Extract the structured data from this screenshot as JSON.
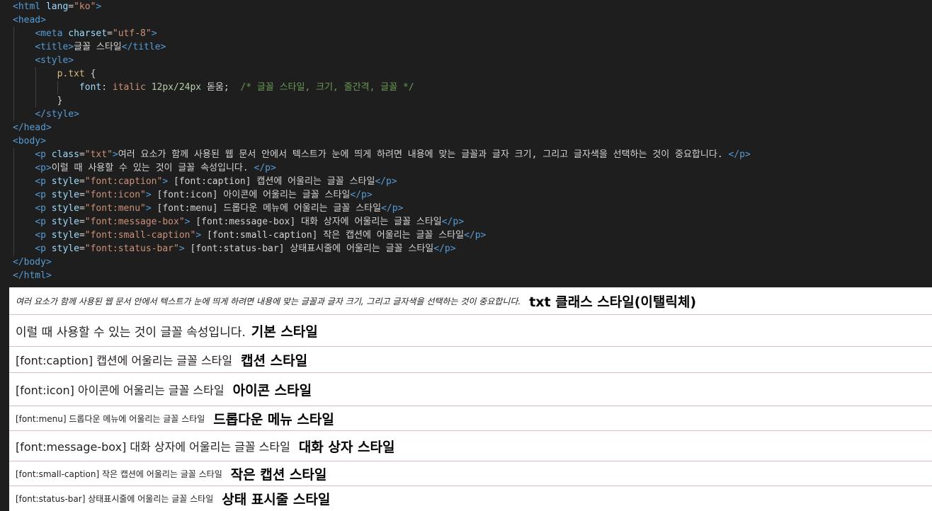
{
  "editor": {
    "lines": [
      [
        [
          "t-tag",
          "<html "
        ],
        [
          "t-attr",
          "lang"
        ],
        [
          "t-txt",
          "="
        ],
        [
          "t-str",
          "\"ko\""
        ],
        [
          "t-tag",
          ">"
        ]
      ],
      [
        [
          "t-tag",
          "<head>"
        ]
      ],
      [
        [
          "t-txt",
          "    "
        ],
        [
          "t-tag",
          "<meta "
        ],
        [
          "t-attr",
          "charset"
        ],
        [
          "t-txt",
          "="
        ],
        [
          "t-str",
          "\"utf-8\""
        ],
        [
          "t-tag",
          ">"
        ]
      ],
      [
        [
          "t-txt",
          "    "
        ],
        [
          "t-tag",
          "<title>"
        ],
        [
          "t-txt",
          "글꼴 스타일"
        ],
        [
          "t-tag",
          "</title>"
        ]
      ],
      [
        [
          "t-txt",
          "    "
        ],
        [
          "t-tag",
          "<style>"
        ]
      ],
      [
        [
          "t-txt",
          "        "
        ],
        [
          "t-sel",
          "p.txt"
        ],
        [
          "t-txt",
          " {"
        ]
      ],
      [
        [
          "t-txt",
          "            "
        ],
        [
          "t-prop",
          "font"
        ],
        [
          "t-txt",
          ": "
        ],
        [
          "t-val",
          "italic "
        ],
        [
          "t-num",
          "12px/24px"
        ],
        [
          "t-txt",
          " 돋움;  "
        ],
        [
          "t-cmt",
          "/* 글꼴 스타일, 크기, 줄간격, 글꼴 */"
        ]
      ],
      [
        [
          "t-txt",
          "        }"
        ]
      ],
      [
        [
          "t-txt",
          "    "
        ],
        [
          "t-tag",
          "</style>"
        ]
      ],
      [
        [
          "t-tag",
          "</head>"
        ]
      ],
      [
        [
          "t-tag",
          "<body>"
        ]
      ],
      [
        [
          "t-txt",
          "    "
        ],
        [
          "t-tag",
          "<p "
        ],
        [
          "t-attr",
          "class"
        ],
        [
          "t-txt",
          "="
        ],
        [
          "t-str",
          "\"txt\""
        ],
        [
          "t-tag",
          ">"
        ],
        [
          "t-txt",
          "여러 요소가 함께 사용된 웹 문서 안에서 텍스트가 눈에 띄게 하려면 내용에 맞는 글꼴과 글자 크기, 그리고 글자색을 선택하는 것이 중요합니다. "
        ],
        [
          "t-tag",
          "</p>"
        ]
      ],
      [
        [
          "t-txt",
          "    "
        ],
        [
          "t-tag",
          "<p>"
        ],
        [
          "t-txt",
          "이럴 때 사용할 수 있는 것이 글꼴 속성입니다. "
        ],
        [
          "t-tag",
          "</p>"
        ]
      ],
      [
        [
          "t-txt",
          "    "
        ],
        [
          "t-tag",
          "<p "
        ],
        [
          "t-attr",
          "style"
        ],
        [
          "t-txt",
          "="
        ],
        [
          "t-str",
          "\"font:caption\""
        ],
        [
          "t-tag",
          ">"
        ],
        [
          "t-txt",
          " [font:caption] 캡션에 어울리는 글꼴 스타일"
        ],
        [
          "t-tag",
          "</p>"
        ]
      ],
      [
        [
          "t-txt",
          "    "
        ],
        [
          "t-tag",
          "<p "
        ],
        [
          "t-attr",
          "style"
        ],
        [
          "t-txt",
          "="
        ],
        [
          "t-str",
          "\"font:icon\""
        ],
        [
          "t-tag",
          ">"
        ],
        [
          "t-txt",
          " [font:icon] 아이콘에 어울리는 글꼴 스타일"
        ],
        [
          "t-tag",
          "</p>"
        ]
      ],
      [
        [
          "t-txt",
          "    "
        ],
        [
          "t-tag",
          "<p "
        ],
        [
          "t-attr",
          "style"
        ],
        [
          "t-txt",
          "="
        ],
        [
          "t-str",
          "\"font:menu\""
        ],
        [
          "t-tag",
          ">"
        ],
        [
          "t-txt",
          " [font:menu] 드롭다운 메뉴에 어울리는 글꼴 스타일"
        ],
        [
          "t-tag",
          "</p>"
        ]
      ],
      [
        [
          "t-txt",
          "    "
        ],
        [
          "t-tag",
          "<p "
        ],
        [
          "t-attr",
          "style"
        ],
        [
          "t-txt",
          "="
        ],
        [
          "t-str",
          "\"font:message-box\""
        ],
        [
          "t-tag",
          ">"
        ],
        [
          "t-txt",
          " [font:message-box] 대화 상자에 어울리는 글꼴 스타일"
        ],
        [
          "t-tag",
          "</p>"
        ]
      ],
      [
        [
          "t-txt",
          "    "
        ],
        [
          "t-tag",
          "<p "
        ],
        [
          "t-attr",
          "style"
        ],
        [
          "t-txt",
          "="
        ],
        [
          "t-str",
          "\"font:small-caption\""
        ],
        [
          "t-tag",
          ">"
        ],
        [
          "t-txt",
          " [font:small-caption] 작은 캡션에 어울리는 글꼴 스타일"
        ],
        [
          "t-tag",
          "</p>"
        ]
      ],
      [
        [
          "t-txt",
          "    "
        ],
        [
          "t-tag",
          "<p "
        ],
        [
          "t-attr",
          "style"
        ],
        [
          "t-txt",
          "="
        ],
        [
          "t-str",
          "\"font:status-bar\""
        ],
        [
          "t-tag",
          ">"
        ],
        [
          "t-txt",
          " [font:status-bar] 상태표시줄에 어울리는 글꼴 스타일"
        ],
        [
          "t-tag",
          "</p>"
        ]
      ],
      [
        [
          "t-tag",
          "</body>"
        ]
      ],
      [
        [
          "t-tag",
          "</html>"
        ]
      ]
    ]
  },
  "preview": {
    "rows": [
      {
        "name": "txt",
        "sample": "여러 요소가 함께 사용된 웹 문서 안에서 텍스트가 눈에 띄게 하려면 내용에 맞는 글꼴과 글자 크기, 그리고 글자색을 선택하는 것이 중요합니다.",
        "label": "txt 클래스 스타일(이탤릭체)"
      },
      {
        "name": "default",
        "sample": "이럴 때 사용할 수 있는 것이 글꼴 속성입니다.",
        "label": "기본 스타일"
      },
      {
        "name": "caption",
        "sample": "[font:caption] 캡션에 어울리는 글꼴 스타일",
        "label": "캡션 스타일"
      },
      {
        "name": "icon",
        "sample": "[font:icon] 아이콘에 어울리는 글꼴 스타일",
        "label": "아이콘 스타일"
      },
      {
        "name": "menu",
        "sample": "[font:menu] 드롭다운 메뉴에 어울리는 글꼴 스타일",
        "label": "드롭다운 메뉴 스타일"
      },
      {
        "name": "message-box",
        "sample": "[font:message-box] 대화 상자에 어울리는 글꼴 스타일",
        "label": "대화 상자 스타일"
      },
      {
        "name": "small-caption",
        "sample": "[font:small-caption] 작은 캡션에 어울리는 글꼴 스타일",
        "label": "작은 캡션 스타일"
      },
      {
        "name": "status-bar",
        "sample": "[font:status-bar] 상태표시줄에 어울리는 글꼴 스타일",
        "label": "상태 표시줄 스타일"
      }
    ]
  }
}
